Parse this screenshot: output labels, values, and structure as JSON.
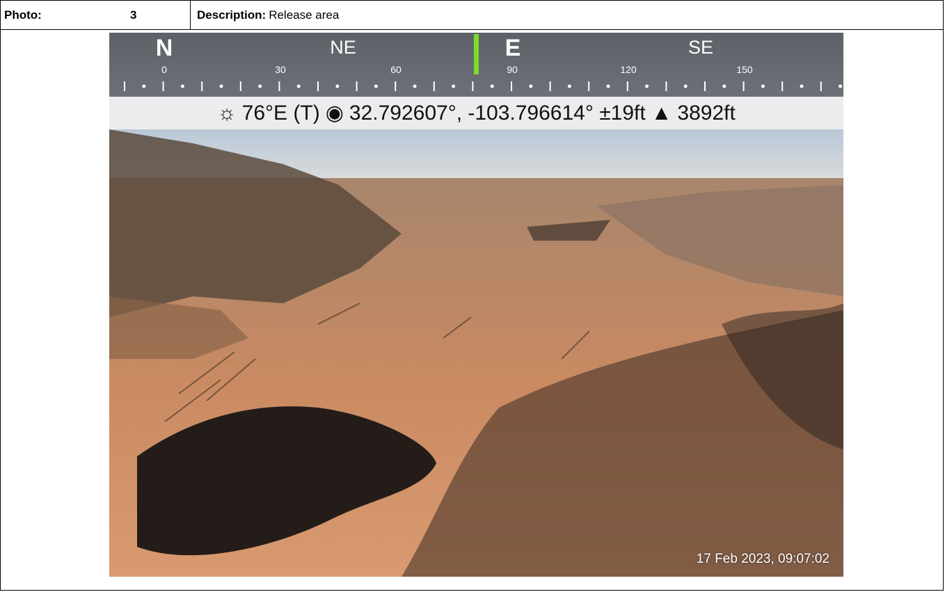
{
  "header": {
    "photo_label": "Photo:",
    "photo_number": "3",
    "description_label": "Description:",
    "description_value": "Release area"
  },
  "compass": {
    "directions": [
      "N",
      "NE",
      "E",
      "SE"
    ],
    "degrees": [
      "0",
      "30",
      "60",
      "90",
      "120",
      "150"
    ],
    "needle_color": "#7ddc2a"
  },
  "info_bar": {
    "heading": "76°E (T)",
    "coordinates": "32.792607°, -103.796614° ±19ft",
    "elevation": "3892ft"
  },
  "timestamp": "17 Feb 2023, 09:07:02"
}
